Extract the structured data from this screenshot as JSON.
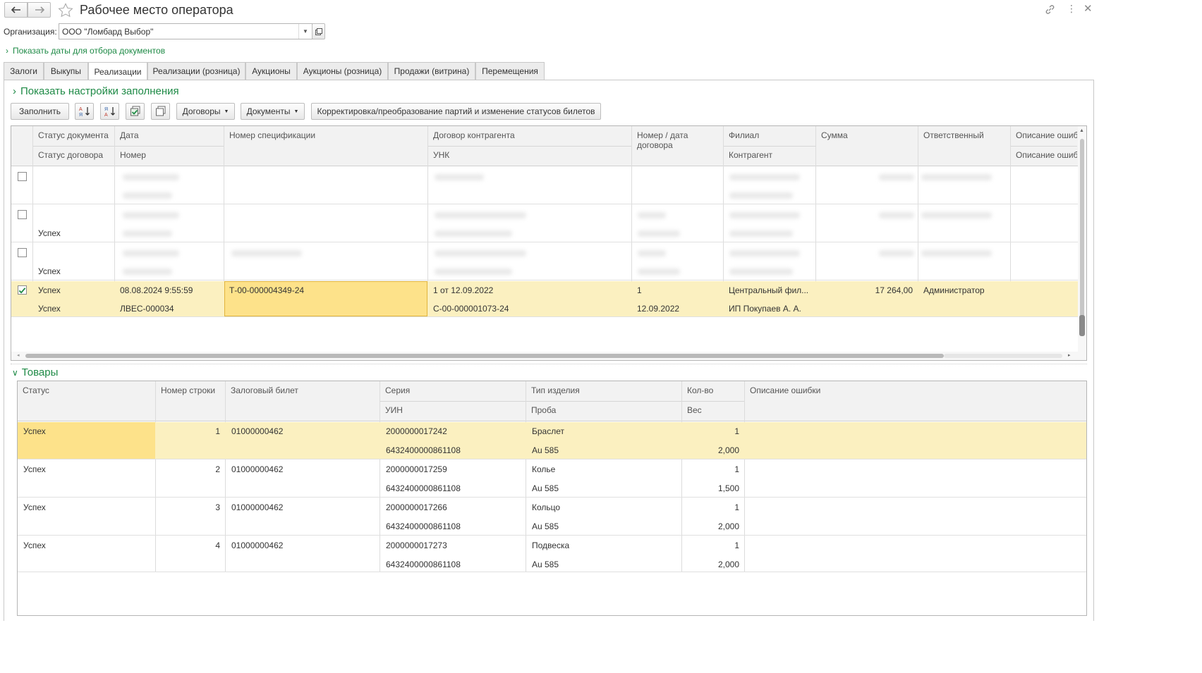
{
  "title": "Рабочее место оператора",
  "org": {
    "label": "Организация:",
    "value": "ООО \"Ломбард Выбор\""
  },
  "show_dates_link": "Показать даты для отбора документов",
  "tabs": [
    "Залоги",
    "Выкупы",
    "Реализации",
    "Реализации (розница)",
    "Аукционы",
    "Аукционы (розница)",
    "Продажи (витрина)",
    "Перемещения"
  ],
  "active_tab": "Реализации",
  "fill_settings_link": "Показать настройки заполнения",
  "toolbar": {
    "fill": "Заполнить",
    "contracts": "Договоры",
    "documents": "Документы",
    "correction": "Корректировка/преобразование партий и изменение статусов билетов"
  },
  "docs_grid": {
    "headers_top": [
      "Статус документа",
      "Дата",
      "Номер спецификации",
      "Договор контрагента",
      "Номер / дата договора",
      "Филиал",
      "Сумма",
      "Ответственный",
      "Описание ошиб"
    ],
    "headers_bottom": [
      "Статус договора",
      "Номер",
      "",
      "УНК",
      "",
      "Контрагент",
      "",
      "",
      "Описание ошиб"
    ],
    "rows": [
      {
        "checked": false,
        "status_doc": "",
        "status_contract": ""
      },
      {
        "checked": false,
        "status_doc": "",
        "status_contract": "Успех"
      },
      {
        "checked": false,
        "status_doc": "",
        "status_contract": "Успех"
      },
      {
        "checked": true,
        "status_doc": "Успех",
        "status_contract": "Успех",
        "date": "08.08.2024 9:55:59",
        "number": "ЛВЕС-000034",
        "spec": "Т-00-000004349-24",
        "contract": "1 от 12.09.2022",
        "unk": "С-00-000001073-24",
        "contract_no": "1",
        "contract_date": "12.09.2022",
        "branch": "Центральный фил...",
        "counterparty": "ИП Покупаев А. А.",
        "sum": "17 264,00",
        "responsible": "Администратор"
      }
    ]
  },
  "goods_section": "Товары",
  "goods_grid": {
    "headers_top": [
      "Статус",
      "Номер строки",
      "Залоговый билет",
      "Серия",
      "Тип изделия",
      "Кол-во",
      "Описание ошибки"
    ],
    "headers_bottom": [
      "",
      "",
      "",
      "УИН",
      "Проба",
      "Вес",
      ""
    ],
    "rows": [
      {
        "status": "Успех",
        "line": "1",
        "ticket": "01000000462",
        "series": "2000000017242",
        "uin": "6432400000861108",
        "type": "Браслет",
        "probe": "Au 585",
        "qty": "1",
        "weight": "2,000"
      },
      {
        "status": "Успех",
        "line": "2",
        "ticket": "01000000462",
        "series": "2000000017259",
        "uin": "6432400000861108",
        "type": "Колье",
        "probe": "Au 585",
        "qty": "1",
        "weight": "1,500"
      },
      {
        "status": "Успех",
        "line": "3",
        "ticket": "01000000462",
        "series": "2000000017266",
        "uin": "6432400000861108",
        "type": "Кольцо",
        "probe": "Au 585",
        "qty": "1",
        "weight": "2,000"
      },
      {
        "status": "Успех",
        "line": "4",
        "ticket": "01000000462",
        "series": "2000000017273",
        "uin": "6432400000861108",
        "type": "Подвеска",
        "probe": "Au 585",
        "qty": "1",
        "weight": "2,000"
      }
    ]
  },
  "colors": {
    "accent_green": "#1e8a46",
    "selected_row": "#fbf0c0",
    "selected_cell": "#fde28a"
  }
}
